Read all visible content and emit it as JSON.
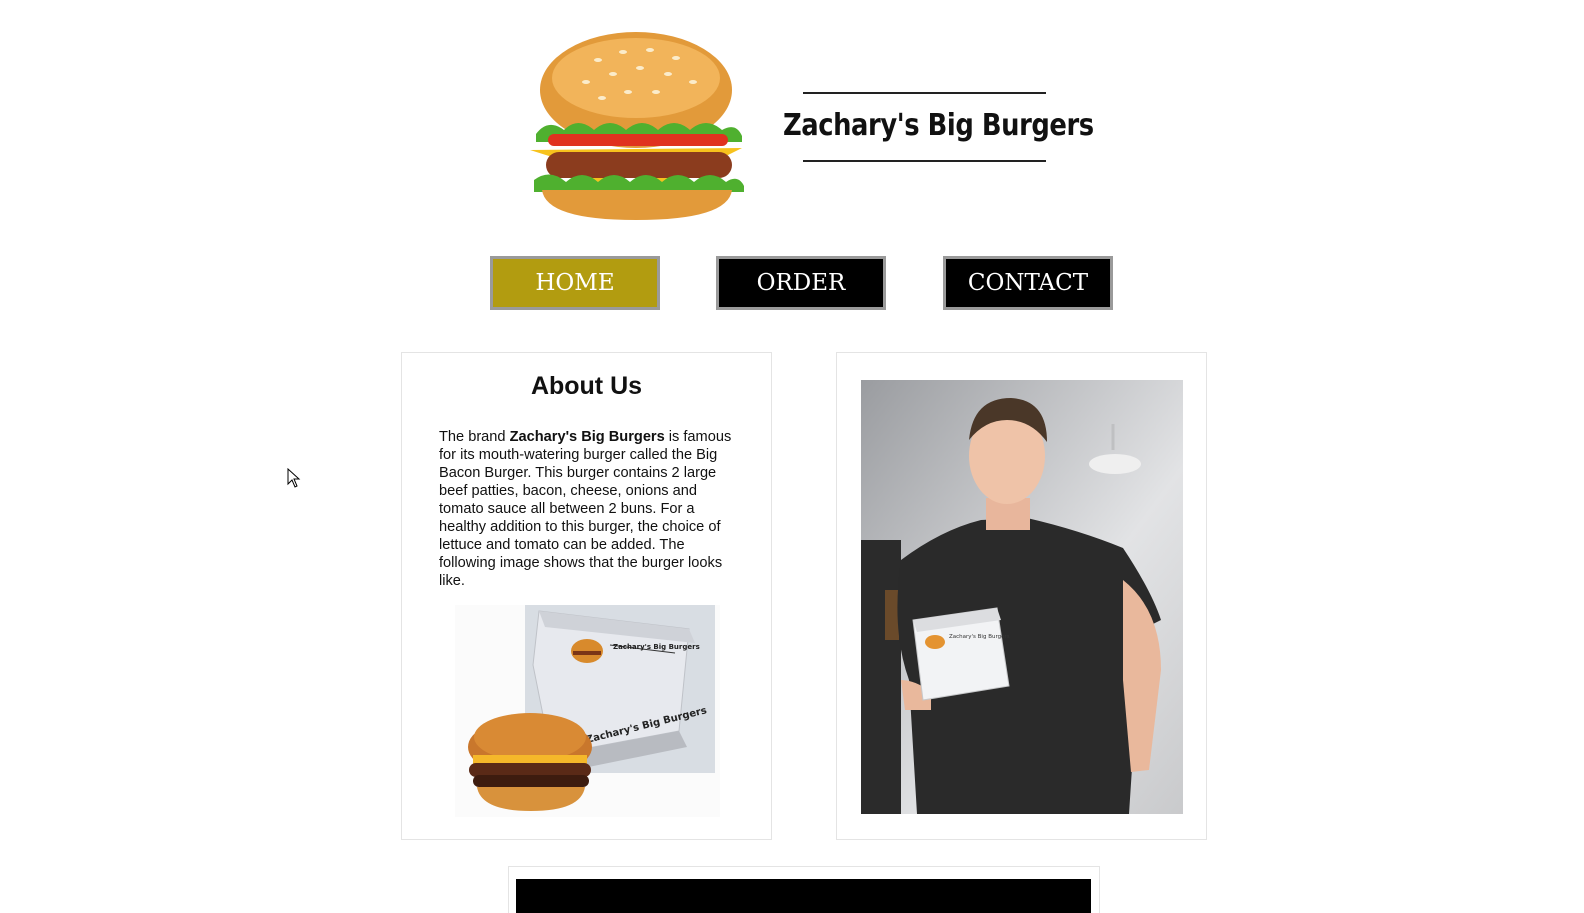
{
  "header": {
    "brand_title": "Zachary's Big Burgers",
    "logo_icon": "burger-logo-icon"
  },
  "nav": {
    "items": [
      {
        "label": "HOME",
        "active": true
      },
      {
        "label": "ORDER",
        "active": false
      },
      {
        "label": "CONTACT",
        "active": false
      }
    ]
  },
  "about": {
    "title": "About Us",
    "intro": "The brand ",
    "brand_bold": "Zachary's Big Burgers",
    "body": " is famous for its mouth-watering burger called the Big Bacon Burger. This burger contains 2 large beef patties, bacon, cheese, onions and tomato sauce all between 2 buns. For a healthy addition to this burger, the choice of lettuce and tomato can be added. The following image shows that the burger looks like.",
    "box_print": "Zachary's Big Burgers"
  },
  "photo": {
    "box_print": "Zachary's Big Burgers"
  },
  "colors": {
    "active_nav": "#b29c10",
    "nav_bg": "#000000",
    "nav_border": "#9a9a9a"
  }
}
